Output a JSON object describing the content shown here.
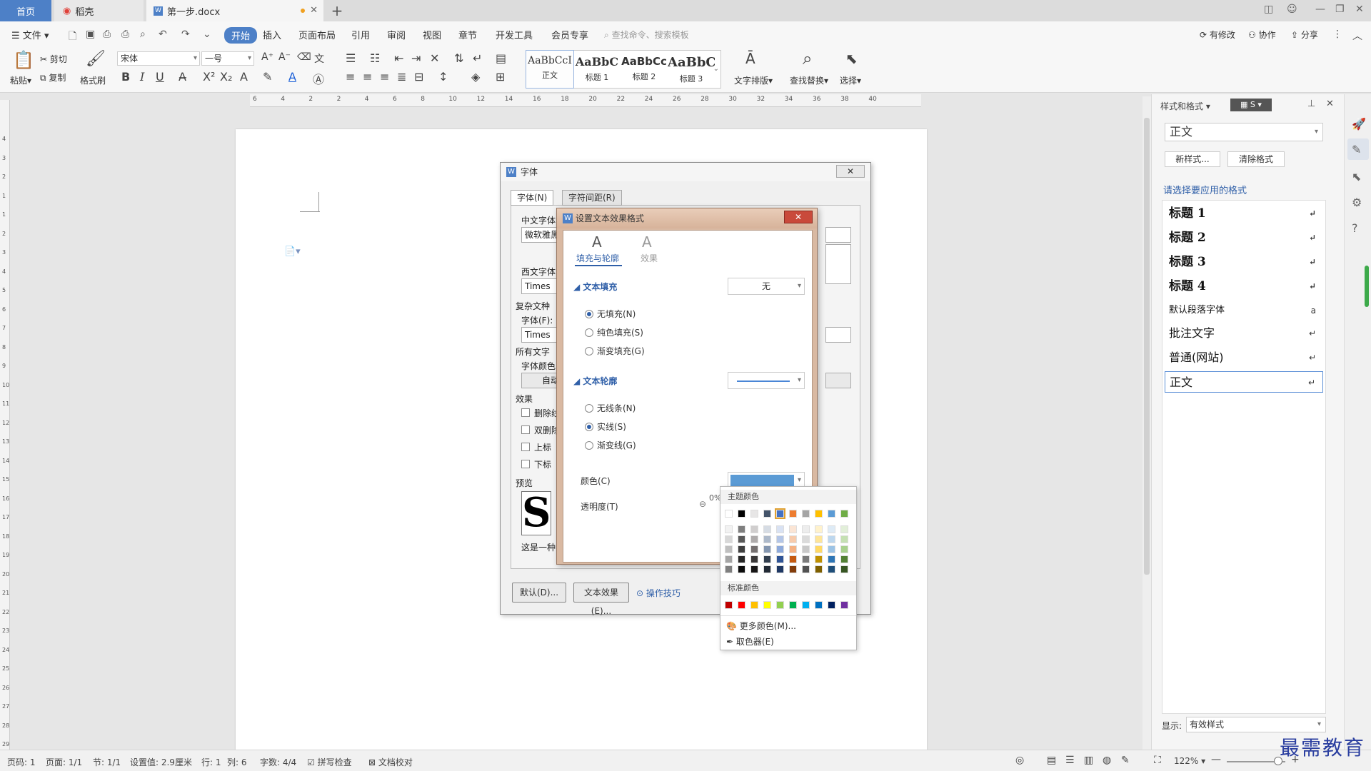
{
  "tabs": {
    "home": "首页",
    "daoke": "稻壳",
    "doc": "第一步.docx"
  },
  "menu": {
    "file": "文件",
    "items": [
      "开始",
      "插入",
      "页面布局",
      "引用",
      "审阅",
      "视图",
      "章节",
      "开发工具",
      "会员专享"
    ],
    "search_placeholder": "查找命令、搜索模板",
    "right": [
      "有修改",
      "协作",
      "分享"
    ]
  },
  "ribbon": {
    "paste": "粘贴",
    "cut": "剪切",
    "copy": "复制",
    "format_painter": "格式刷",
    "font_name": "宋体",
    "font_size": "一号",
    "styles": [
      {
        "preview": "AaBbCcI",
        "label": "正文"
      },
      {
        "preview": "AaBbC",
        "label": "标题 1"
      },
      {
        "preview": "AaBbCc",
        "label": "标题 2"
      },
      {
        "preview": "AaBbC",
        "label": "标题 3"
      }
    ],
    "text_layout": "文字排版",
    "find_replace": "查找替换",
    "select": "选择"
  },
  "ruler": [
    "6",
    "4",
    "2",
    "2",
    "4",
    "6",
    "8",
    "10",
    "12",
    "14",
    "16",
    "18",
    "20",
    "22",
    "24",
    "26",
    "28",
    "30",
    "32",
    "34",
    "36",
    "38",
    "40"
  ],
  "vruler": [
    "4",
    "3",
    "2",
    "1",
    "1",
    "2",
    "3",
    "4",
    "5",
    "6",
    "7",
    "8",
    "9",
    "10",
    "11",
    "12",
    "13",
    "14",
    "15",
    "16",
    "17",
    "18",
    "19",
    "20",
    "21",
    "22",
    "23",
    "24",
    "25",
    "26",
    "27",
    "28",
    "29"
  ],
  "side_panel": {
    "title": "样式和格式",
    "current": "正文",
    "new_style": "新样式...",
    "clear_format": "清除格式",
    "prompt": "请选择要应用的格式",
    "styles": [
      "标题 1",
      "标题 2",
      "标题 3",
      "标题 4",
      "默认段落字体",
      "批注文字",
      "普通(网站)",
      "正文"
    ],
    "show_label": "显示:",
    "show_value": "有效样式"
  },
  "font_dialog": {
    "title": "字体",
    "tab_font": "字体(N)",
    "tab_spacing": "字符间距(R)",
    "cn_font_label": "中文字体",
    "cn_font_value": "微软雅黑",
    "west_font_label": "西文字体",
    "west_font_value": "Times",
    "complex_label": "复杂文种",
    "font_label": "字体(F):",
    "font_value": "Times",
    "all_text_label": "所有文字",
    "font_color_label": "字体颜色",
    "font_color_value": "自动",
    "effects_label": "效果",
    "effects": [
      "删除线",
      "双删除线",
      "上标",
      "下标"
    ],
    "preview_label": "预览",
    "preview_char": "S",
    "preview_note": "这是一种",
    "btn_default": "默认(D)...",
    "btn_text_effect": "文本效果(E)...",
    "tips": "操作技巧"
  },
  "effect_dialog": {
    "title": "设置文本效果格式",
    "tab_fill": "填充与轮廓",
    "tab_effect": "效果",
    "fill_section": "文本填充",
    "fill_value": "无",
    "fill_options": [
      "无填充(N)",
      "纯色填充(S)",
      "渐变填充(G)"
    ],
    "outline_section": "文本轮廓",
    "outline_options": [
      "无线条(N)",
      "实线(S)",
      "渐变线(G)"
    ],
    "color_label": "颜色(C)",
    "transparency_label": "透明度(T)",
    "transparency_value": "0%"
  },
  "color_picker": {
    "theme_label": "主题颜色",
    "standard_label": "标准颜色",
    "more_colors": "更多颜色(M)...",
    "eyedropper": "取色器(E)",
    "theme_top": [
      "#ffffff",
      "#000000",
      "#e7e6e6",
      "#44546a",
      "#4472c4",
      "#ed7d31",
      "#a5a5a5",
      "#ffc000",
      "#5b9bd5",
      "#70ad47"
    ],
    "theme_shades": [
      [
        "#f2f2f2",
        "#7f7f7f",
        "#d0cece",
        "#d6dce4",
        "#d9e2f3",
        "#fbe5d5",
        "#ededed",
        "#fff2cc",
        "#deebf6",
        "#e2efd9"
      ],
      [
        "#d8d8d8",
        "#595959",
        "#aeabab",
        "#adb9ca",
        "#b4c6e7",
        "#f7cbac",
        "#dbdbdb",
        "#fee599",
        "#bdd7ee",
        "#c5e0b3"
      ],
      [
        "#bfbfbf",
        "#3f3f3f",
        "#757070",
        "#8496b0",
        "#8eaadb",
        "#f4b183",
        "#c9c9c9",
        "#ffd965",
        "#9cc3e5",
        "#a8d08d"
      ],
      [
        "#a5a5a5",
        "#262626",
        "#3a3838",
        "#323f4f",
        "#2f5496",
        "#c55a11",
        "#7b7b7b",
        "#bf9000",
        "#2e75b5",
        "#538135"
      ],
      [
        "#7f7f7f",
        "#0c0c0c",
        "#171616",
        "#222a35",
        "#1f3864",
        "#833c0b",
        "#525252",
        "#7f6000",
        "#1e4e79",
        "#375623"
      ]
    ],
    "standard": [
      "#c00000",
      "#ff0000",
      "#ffc000",
      "#ffff00",
      "#92d050",
      "#00b050",
      "#00b0f0",
      "#0070c0",
      "#002060",
      "#7030a0"
    ]
  },
  "statusbar": {
    "items": [
      "页码: 1",
      "页面: 1/1",
      "节: 1/1",
      "设置值: 2.9厘米",
      "行: 1",
      "列: 6",
      "字数: 4/4",
      "拼写检查",
      "文档校对"
    ],
    "zoom": "122%"
  },
  "watermark": "最需教育"
}
